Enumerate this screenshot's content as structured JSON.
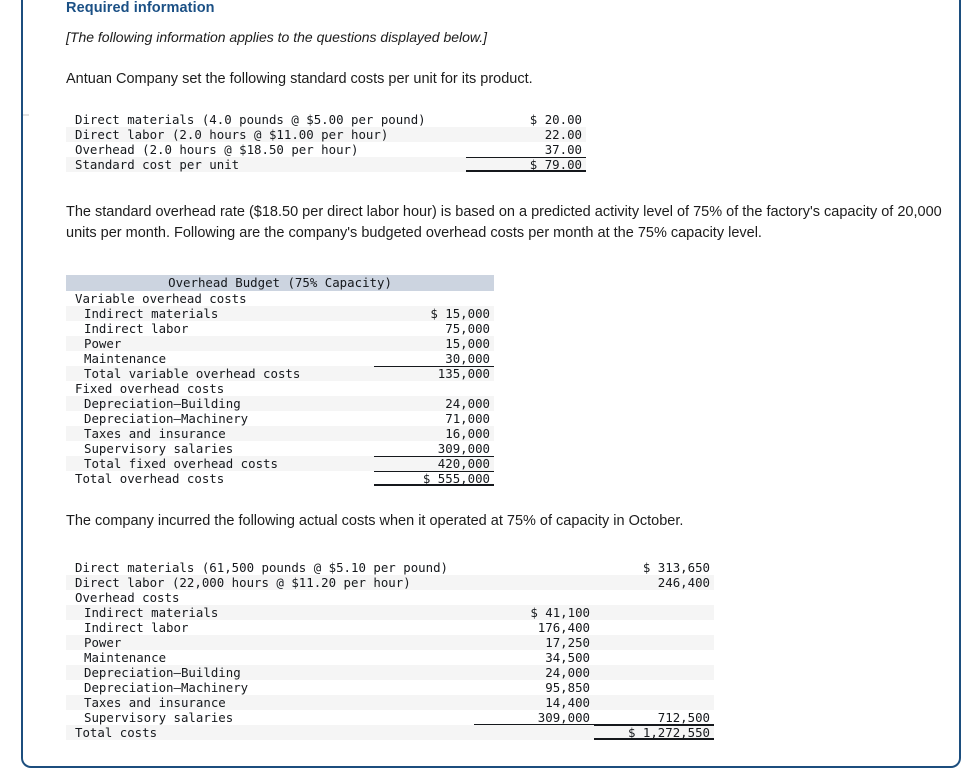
{
  "panel": {
    "heading": "Required information",
    "applies_note": "[The following information applies to the questions displayed below.]",
    "intro_paragraph": "Antuan Company set the following standard costs per unit for its product.",
    "overhead_paragraph": "The standard overhead rate ($18.50 per direct labor hour) is based on a predicted activity level of 75% of the factory's capacity of 20,000 units per month. Following are the company's budgeted overhead costs per month at the 75% capacity level.",
    "actual_paragraph": "The company incurred the following actual costs when it operated at 75% of capacity in October."
  },
  "colors": {
    "heading_blue": "#1b5085",
    "panel_border": "#1c4e7e",
    "table_header_bg": "#ccd4e0",
    "stripe_bg": "#f5f5f5",
    "text": "#15181c"
  },
  "standard_costs_table": {
    "rows": [
      {
        "label": "Direct materials (4.0 pounds @ $5.00 per pound)",
        "amount": "$ 20.00",
        "indent": 0,
        "stripe": false,
        "rule": "none"
      },
      {
        "label": "Direct labor (2.0 hours @ $11.00 per hour)",
        "amount": "22.00",
        "indent": 0,
        "stripe": true,
        "rule": "none"
      },
      {
        "label": "Overhead (2.0 hours @ $18.50 per hour)",
        "amount": "37.00",
        "indent": 0,
        "stripe": false,
        "rule": "none"
      },
      {
        "label": "Standard cost per unit",
        "amount": "$ 79.00",
        "indent": 0,
        "stripe": true,
        "rule": "double"
      }
    ]
  },
  "overhead_budget_table": {
    "header": "Overhead Budget (75% Capacity)",
    "rows": [
      {
        "label": "Variable overhead costs",
        "amount": "",
        "indent": 0,
        "stripe": false,
        "rule": "none"
      },
      {
        "label": "Indirect materials",
        "amount": "$ 15,000",
        "indent": 1,
        "stripe": true,
        "rule": "none"
      },
      {
        "label": "Indirect labor",
        "amount": "75,000",
        "indent": 1,
        "stripe": false,
        "rule": "none"
      },
      {
        "label": "Power",
        "amount": "15,000",
        "indent": 1,
        "stripe": true,
        "rule": "none"
      },
      {
        "label": "Maintenance",
        "amount": "30,000",
        "indent": 1,
        "stripe": false,
        "rule": "none"
      },
      {
        "label": "Total variable overhead costs",
        "amount": "135,000",
        "indent": 1,
        "stripe": true,
        "rule": "top"
      },
      {
        "label": "Fixed overhead costs",
        "amount": "",
        "indent": 0,
        "stripe": false,
        "rule": "none"
      },
      {
        "label": "Depreciation—Building",
        "amount": "24,000",
        "indent": 1,
        "stripe": true,
        "rule": "none"
      },
      {
        "label": "Depreciation—Machinery",
        "amount": "71,000",
        "indent": 1,
        "stripe": false,
        "rule": "none"
      },
      {
        "label": "Taxes and insurance",
        "amount": "16,000",
        "indent": 1,
        "stripe": true,
        "rule": "none"
      },
      {
        "label": "Supervisory salaries",
        "amount": "309,000",
        "indent": 1,
        "stripe": false,
        "rule": "none"
      },
      {
        "label": "Total fixed overhead costs",
        "amount": "420,000",
        "indent": 1,
        "stripe": true,
        "rule": "top"
      },
      {
        "label": "Total overhead costs",
        "amount": "$ 555,000",
        "indent": 0,
        "stripe": false,
        "rule": "double"
      }
    ]
  },
  "actual_costs_table": {
    "rows": [
      {
        "label": "Direct materials (61,500 pounds @ $5.10 per pound)",
        "amount_mid": "",
        "amount_right": "$ 313,650",
        "indent": 0,
        "stripe": false,
        "rule": "none"
      },
      {
        "label": "Direct labor (22,000 hours @ $11.20 per hour)",
        "amount_mid": "",
        "amount_right": "246,400",
        "indent": 0,
        "stripe": true,
        "rule": "none"
      },
      {
        "label": "Overhead costs",
        "amount_mid": "",
        "amount_right": "",
        "indent": 0,
        "stripe": false,
        "rule": "none"
      },
      {
        "label": "Indirect materials",
        "amount_mid": "$ 41,100",
        "amount_right": "",
        "indent": 1,
        "stripe": true,
        "rule": "none"
      },
      {
        "label": "Indirect labor",
        "amount_mid": "176,400",
        "amount_right": "",
        "indent": 1,
        "stripe": false,
        "rule": "none"
      },
      {
        "label": "Power",
        "amount_mid": "17,250",
        "amount_right": "",
        "indent": 1,
        "stripe": true,
        "rule": "none"
      },
      {
        "label": "Maintenance",
        "amount_mid": "34,500",
        "amount_right": "",
        "indent": 1,
        "stripe": false,
        "rule": "none"
      },
      {
        "label": "Depreciation—Building",
        "amount_mid": "24,000",
        "amount_right": "",
        "indent": 1,
        "stripe": true,
        "rule": "none"
      },
      {
        "label": "Depreciation—Machinery",
        "amount_mid": "95,850",
        "amount_right": "",
        "indent": 1,
        "stripe": false,
        "rule": "none"
      },
      {
        "label": "Taxes and insurance",
        "amount_mid": "14,400",
        "amount_right": "",
        "indent": 1,
        "stripe": true,
        "rule": "none"
      },
      {
        "label": "Supervisory salaries",
        "amount_mid": "309,000",
        "amount_right": "712,500",
        "indent": 1,
        "stripe": false,
        "rule": "none"
      },
      {
        "label": "Total costs",
        "amount_mid": "",
        "amount_right": "$ 1,272,550",
        "indent": 0,
        "stripe": true,
        "rule": "double-right"
      }
    ]
  }
}
